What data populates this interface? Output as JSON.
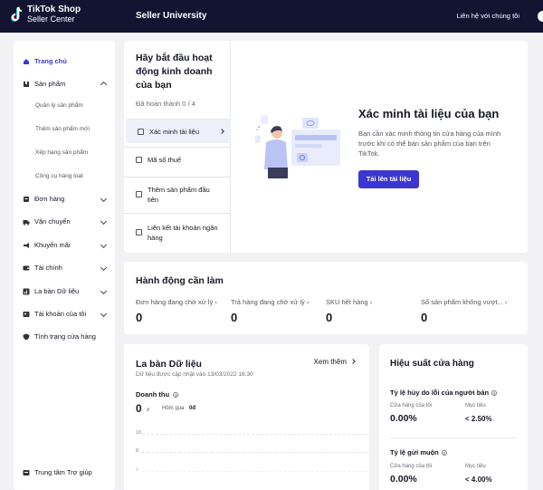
{
  "topbar": {
    "logo_line1": "TikTok Shop",
    "logo_line2": "Seller Center",
    "title": "Seller University",
    "contact": "Liên hệ với chúng tôi"
  },
  "sidebar": {
    "items": [
      {
        "label": "Trang chủ",
        "icon": "home-icon"
      },
      {
        "label": "Sản phẩm",
        "icon": "box-icon"
      },
      {
        "label": "Đơn hàng",
        "icon": "orders-icon"
      },
      {
        "label": "Vận chuyển",
        "icon": "truck-icon"
      },
      {
        "label": "Khuyến mãi",
        "icon": "megaphone-icon"
      },
      {
        "label": "Tài chính",
        "icon": "wallet-icon"
      },
      {
        "label": "La bàn Dữ liệu",
        "icon": "chart-icon"
      },
      {
        "label": "Tài khoản của tôi",
        "icon": "user-icon"
      },
      {
        "label": "Tình trạng cửa hàng",
        "icon": "shield-icon"
      }
    ],
    "product_sub": [
      "Quản lý sản phẩm",
      "Thêm sản phẩm mới",
      "Xếp hạng sản phẩm",
      "Công cụ hàng loạt"
    ],
    "help": "Trung tâm Trợ giúp"
  },
  "getting_started": {
    "title": "Hãy bắt đầu hoạt động kinh doanh của bạn",
    "progress": "Đã hoàn thành 0 / 4",
    "steps": [
      "Xác minh tài liệu",
      "Mã số thuế",
      "Thêm sản phẩm đầu tiên",
      "Liên kết tài khoản ngân hàng"
    ],
    "verify_title": "Xác minh tài liệu của bạn",
    "verify_desc": "Bạn cần xác minh thông tin cửa hàng của mình trước khi có thể bán sản phẩm của bạn trên TikTok.",
    "upload_button": "Tải lên tài liệu"
  },
  "actions": {
    "title": "Hành động cần làm",
    "items": [
      {
        "label": "Đơn hàng đang chờ xử lý",
        "value": "0"
      },
      {
        "label": "Trả hàng đang chờ xử lý",
        "value": "0"
      },
      {
        "label": "SKU hết hàng",
        "value": "0"
      },
      {
        "label": "Số sản phẩm không vượt...",
        "value": "0"
      }
    ]
  },
  "compass": {
    "title": "La bàn Dữ liệu",
    "more": "Xem thêm",
    "updated": "Dữ liệu được cập nhật vào 13/03/2022 16:30",
    "revenue_label": "Doanh thu",
    "revenue_value": "0",
    "revenue_unit": "đ",
    "yesterday_label": "Hôm qua",
    "yesterday_value": "0đ",
    "grid_labels": [
      "10",
      "8",
      "6"
    ]
  },
  "performance": {
    "title": "Hiệu suất cửa hàng",
    "metrics": [
      {
        "title": "Tỷ lệ hủy do lỗi của người bán",
        "shop_label": "Cửa hàng của tôi",
        "shop_value": "0.00%",
        "target_label": "Mục tiêu",
        "target_value": "< 2.50%"
      },
      {
        "title": "Tỷ lệ gửi muộn",
        "shop_label": "Cửa hàng của tôi",
        "shop_value": "0.00%",
        "target_label": "Mục tiêu",
        "target_value": "< 4.00%"
      }
    ]
  },
  "colors": {
    "topbar": "#121430",
    "accent": "#3b36d1",
    "background": "#f2f2f5"
  }
}
